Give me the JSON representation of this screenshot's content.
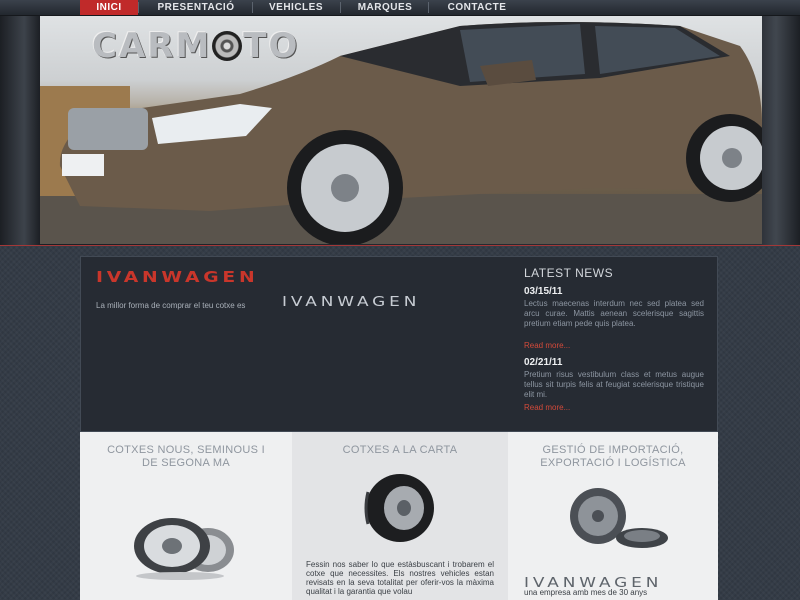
{
  "nav": {
    "items": [
      {
        "label": "INICI"
      },
      {
        "label": "PRESENTACIÓ"
      },
      {
        "label": "VEHICLES"
      },
      {
        "label": "MARQUES"
      },
      {
        "label": "CONTACTE"
      }
    ],
    "active_index": 0
  },
  "hero": {
    "logo_part1": "CARM",
    "logo_part2": "TO"
  },
  "intro": {
    "title": "IVANWAGEN",
    "text": "La millor forma de comprar el teu cotxe es",
    "brand": "IVANWAGEN"
  },
  "news": {
    "title": "LATEST NEWS",
    "items": [
      {
        "date": "03/15/11",
        "text": "Lectus maecenas interdum nec sed platea sed arcu curae. Mattis aenean scelerisque sagittis pretium etiam pede quis platea.",
        "more": "Read more..."
      },
      {
        "date": "02/21/11",
        "text": "Pretium risus vestibulum class et metus augue tellus sit turpis felis at feugiat scelerisque tristique elit mi.",
        "more": "Read more..."
      }
    ]
  },
  "columns": [
    {
      "title": "COTXES NOUS, SEMINOUS I DE SEGONA MA",
      "icon": "wheel-rims-icon"
    },
    {
      "title": "COTXES A LA CARTA",
      "icon": "tire-icon",
      "text": "Fessin nos saber lo que estàsbuscant i trobarem el cotxe que necessites. Els nostres vehicles estan revisats en la seva totalitat per oferir-vos la màxima qualitat i la garantia que volau"
    },
    {
      "title": "GESTIÓ DE IMPORTACIÓ, EXPORTACIÓ I LOGÍSTICA",
      "icon": "gears-icon",
      "brand": "IVANWAGEN",
      "text": "una empresa amb mes de 30 anys"
    }
  ],
  "colors": {
    "accent": "#c02a2a",
    "panel": "#262b33",
    "link": "#d24a3a"
  }
}
